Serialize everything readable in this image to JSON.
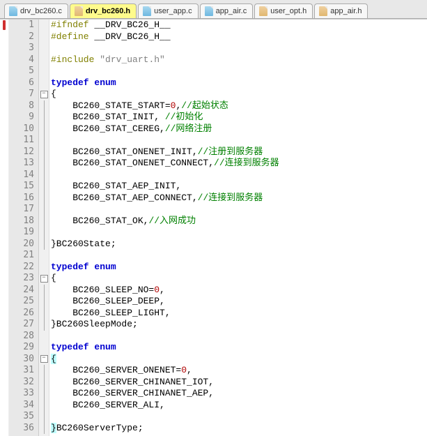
{
  "tabs": [
    {
      "name": "drv_bc260.c",
      "type": "c",
      "active": false
    },
    {
      "name": "drv_bc260.h",
      "type": "h",
      "active": true
    },
    {
      "name": "user_app.c",
      "type": "c",
      "active": false
    },
    {
      "name": "app_air.c",
      "type": "c",
      "active": false
    },
    {
      "name": "user_opt.h",
      "type": "h",
      "active": false
    },
    {
      "name": "app_air.h",
      "type": "h",
      "active": false
    }
  ],
  "code": {
    "lines": [
      {
        "n": 1,
        "fold": "",
        "bkmk": true,
        "seg": [
          [
            "def",
            "#ifndef"
          ],
          [
            "id",
            " __DRV_BC26_H__"
          ]
        ]
      },
      {
        "n": 2,
        "fold": "",
        "bkmk": false,
        "seg": [
          [
            "def",
            "#define"
          ],
          [
            "id",
            " __DRV_BC26_H__"
          ]
        ]
      },
      {
        "n": 3,
        "fold": "",
        "bkmk": false,
        "seg": []
      },
      {
        "n": 4,
        "fold": "",
        "bkmk": false,
        "seg": [
          [
            "def",
            "#include"
          ],
          [
            "id",
            " "
          ],
          [
            "str",
            "\"drv_uart.h\""
          ]
        ]
      },
      {
        "n": 5,
        "fold": "",
        "bkmk": false,
        "seg": []
      },
      {
        "n": 6,
        "fold": "",
        "bkmk": false,
        "seg": [
          [
            "kw",
            "typedef"
          ],
          [
            "id",
            " "
          ],
          [
            "kw",
            "enum"
          ]
        ]
      },
      {
        "n": 7,
        "fold": "box",
        "bkmk": false,
        "seg": [
          [
            "id",
            "{"
          ]
        ]
      },
      {
        "n": 8,
        "fold": "line",
        "bkmk": false,
        "seg": [
          [
            "id",
            "    BC260_STATE_START="
          ],
          [
            "num",
            "0"
          ],
          [
            "id",
            ","
          ],
          [
            "com",
            "//起始状态"
          ]
        ]
      },
      {
        "n": 9,
        "fold": "line",
        "bkmk": false,
        "seg": [
          [
            "id",
            "    BC260_STAT_INIT, "
          ],
          [
            "com",
            "//初始化"
          ]
        ]
      },
      {
        "n": 10,
        "fold": "line",
        "bkmk": false,
        "seg": [
          [
            "id",
            "    BC260_STAT_CEREG,"
          ],
          [
            "com",
            "//网络注册"
          ]
        ]
      },
      {
        "n": 11,
        "fold": "line",
        "bkmk": false,
        "seg": []
      },
      {
        "n": 12,
        "fold": "line",
        "bkmk": false,
        "seg": [
          [
            "id",
            "    BC260_STAT_ONENET_INIT,"
          ],
          [
            "com",
            "//注册到服务器"
          ]
        ]
      },
      {
        "n": 13,
        "fold": "line",
        "bkmk": false,
        "seg": [
          [
            "id",
            "    BC260_STAT_ONENET_CONNECT,"
          ],
          [
            "com",
            "//连接到服务器"
          ]
        ]
      },
      {
        "n": 14,
        "fold": "line",
        "bkmk": false,
        "seg": []
      },
      {
        "n": 15,
        "fold": "line",
        "bkmk": false,
        "seg": [
          [
            "id",
            "    BC260_STAT_AEP_INIT,"
          ]
        ]
      },
      {
        "n": 16,
        "fold": "line",
        "bkmk": false,
        "seg": [
          [
            "id",
            "    BC260_STAT_AEP_CONNECT,"
          ],
          [
            "com",
            "//连接到服务器"
          ]
        ]
      },
      {
        "n": 17,
        "fold": "line",
        "bkmk": false,
        "seg": []
      },
      {
        "n": 18,
        "fold": "line",
        "bkmk": false,
        "seg": [
          [
            "id",
            "    BC260_STAT_OK,"
          ],
          [
            "com",
            "//入网成功"
          ]
        ]
      },
      {
        "n": 19,
        "fold": "line",
        "bkmk": false,
        "seg": []
      },
      {
        "n": 20,
        "fold": "end",
        "bkmk": false,
        "seg": [
          [
            "id",
            "}BC260State;"
          ]
        ]
      },
      {
        "n": 21,
        "fold": "",
        "bkmk": false,
        "seg": []
      },
      {
        "n": 22,
        "fold": "",
        "bkmk": false,
        "seg": [
          [
            "kw",
            "typedef"
          ],
          [
            "id",
            " "
          ],
          [
            "kw",
            "enum"
          ]
        ]
      },
      {
        "n": 23,
        "fold": "box",
        "bkmk": false,
        "seg": [
          [
            "id",
            "{"
          ]
        ]
      },
      {
        "n": 24,
        "fold": "line",
        "bkmk": false,
        "seg": [
          [
            "id",
            "    BC260_SLEEP_NO="
          ],
          [
            "num",
            "0"
          ],
          [
            "id",
            ","
          ]
        ]
      },
      {
        "n": 25,
        "fold": "line",
        "bkmk": false,
        "seg": [
          [
            "id",
            "    BC260_SLEEP_DEEP,"
          ]
        ]
      },
      {
        "n": 26,
        "fold": "line",
        "bkmk": false,
        "seg": [
          [
            "id",
            "    BC260_SLEEP_LIGHT,"
          ]
        ]
      },
      {
        "n": 27,
        "fold": "end",
        "bkmk": false,
        "seg": [
          [
            "id",
            "}BC260SleepMode;"
          ]
        ]
      },
      {
        "n": 28,
        "fold": "",
        "bkmk": false,
        "seg": []
      },
      {
        "n": 29,
        "fold": "",
        "bkmk": false,
        "seg": [
          [
            "kw",
            "typedef"
          ],
          [
            "id",
            " "
          ],
          [
            "kw",
            "enum"
          ]
        ]
      },
      {
        "n": 30,
        "fold": "box",
        "bkmk": false,
        "seg": [
          [
            "hl",
            "{"
          ]
        ],
        "cursor": 0
      },
      {
        "n": 31,
        "fold": "line",
        "bkmk": false,
        "seg": [
          [
            "id",
            "    BC260_SERVER_ONENET="
          ],
          [
            "num",
            "0"
          ],
          [
            "id",
            ","
          ]
        ]
      },
      {
        "n": 32,
        "fold": "line",
        "bkmk": false,
        "seg": [
          [
            "id",
            "    BC260_SERVER_CHINANET_IOT,"
          ]
        ]
      },
      {
        "n": 33,
        "fold": "line",
        "bkmk": false,
        "seg": [
          [
            "id",
            "    BC260_SERVER_CHINANET_AEP,"
          ]
        ]
      },
      {
        "n": 34,
        "fold": "line",
        "bkmk": false,
        "seg": [
          [
            "id",
            "    BC260_SERVER_ALI,"
          ]
        ]
      },
      {
        "n": 35,
        "fold": "line",
        "bkmk": false,
        "seg": []
      },
      {
        "n": 36,
        "fold": "end",
        "bkmk": false,
        "seg": [
          [
            "hl",
            "}"
          ],
          [
            "id",
            "BC260ServerType;"
          ]
        ],
        "hlFirst": true
      }
    ]
  }
}
